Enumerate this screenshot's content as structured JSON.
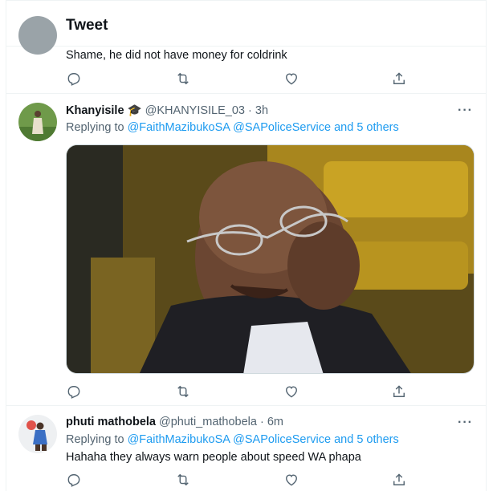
{
  "header": {
    "title": "Tweet"
  },
  "tweets": [
    {
      "text": "Shame, he did not have money for coldrink"
    },
    {
      "name": "Khanyisile",
      "badge": "🎓",
      "handle": "@KHANYISILE_03",
      "time": "· 3h",
      "replying_prefix": "Replying to ",
      "replying_users": "@FaithMazibukoSA @SAPoliceService",
      "replying_and": " and ",
      "replying_others": "5 others",
      "more": "···"
    },
    {
      "name": "phuti mathobela",
      "handle": "@phuti_mathobela",
      "time": "· 6m",
      "replying_prefix": "Replying to ",
      "replying_users": "@FaithMazibukoSA @SAPoliceService",
      "replying_and": " and ",
      "replying_others": "5 others",
      "text": "Hahaha they always warn people about speed WA phapa",
      "more": "···"
    }
  ],
  "icons": {
    "back": "arrow-left-icon",
    "reply": "reply-icon",
    "retweet": "retweet-icon",
    "like": "heart-icon",
    "share": "share-icon",
    "more": "more-icon"
  },
  "colors": {
    "accent": "#1d9bf0",
    "secondary_text": "#536471",
    "divider": "#eff3f4"
  }
}
